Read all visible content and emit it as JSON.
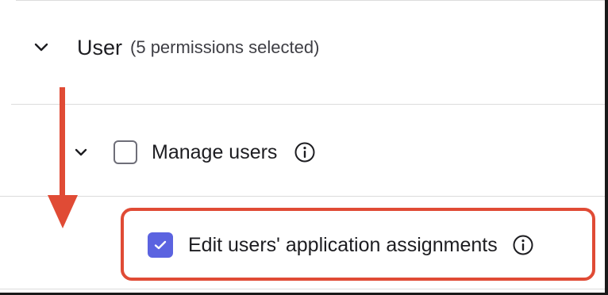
{
  "permission_group": {
    "title": "User",
    "selected_count_text": "(5 permissions selected)",
    "expanded": true,
    "expand_icon": "chevron-down-icon"
  },
  "permissions": [
    {
      "label": "Manage users",
      "checked": false,
      "expand_icon": "chevron-down-icon",
      "info_icon": "info-icon"
    },
    {
      "label": "Edit users' application assignments",
      "checked": true,
      "info_icon": "info-icon"
    }
  ],
  "annotations": {
    "color": "#e04b35",
    "arrow": "arrow-down",
    "highlight": "highlight-box"
  },
  "colors": {
    "checkbox_checked": "#5b63e0",
    "text_primary": "#1d1d21",
    "divider": "#dcdcdc"
  }
}
